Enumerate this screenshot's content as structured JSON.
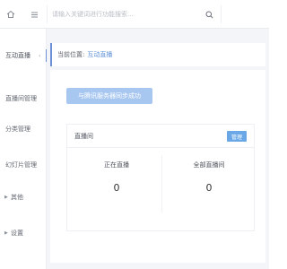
{
  "header": {
    "search_placeholder": "请输入关键词进行功能搜索..."
  },
  "icons": {
    "home": "home-icon",
    "menu": "menu-icon",
    "search": "search-icon"
  },
  "sidebar": {
    "items": [
      {
        "label": "互动直播",
        "active": true
      },
      {
        "label": "直播间管理"
      },
      {
        "label": "分类管理"
      },
      {
        "label": "幻灯片管理"
      },
      {
        "label": "其他"
      },
      {
        "label": "设置"
      }
    ]
  },
  "breadcrumb": {
    "prefix": "当前位置:",
    "current": "互动直播"
  },
  "actions": {
    "sync_label": "与腾讯服务器同步成功"
  },
  "card": {
    "title": "直播间",
    "badge": "管理",
    "stats": [
      {
        "label": "正在直播",
        "value": "0"
      },
      {
        "label": "全部直播间",
        "value": "0"
      }
    ]
  },
  "colors": {
    "accent": "#6c8fd6",
    "button": "#a8c7f0",
    "badge": "#6aa7e6"
  }
}
